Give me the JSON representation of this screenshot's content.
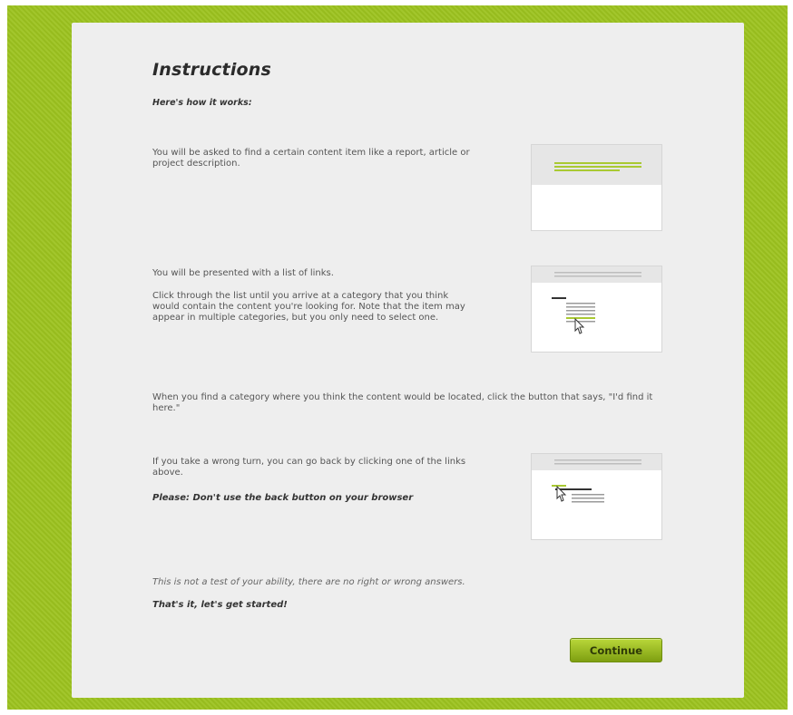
{
  "instructions": {
    "title": "Instructions",
    "subtitle": "Here's how it works:",
    "step1": "You will be asked to find a certain content item like a report, article or project description.",
    "step2_line1": "You will be presented with a list of links.",
    "step2_line2": "Click through the list until you arrive at a category that you think would contain the content you're looking for. Note that the item may appear in multiple categories, but you only need to select one.",
    "step3": "When you find a category where you think the content would be located, click the button that says, \"I'd find it here.\"",
    "step4_line1": "If you take a wrong turn, you can go back by clicking one of the links above.",
    "step4_warning": "Please: Don't use the back button on your browser",
    "note": "This is not a test of your ability, there are no right or wrong answers.",
    "closing": "That's it, let's get started!"
  },
  "illustrations": [
    {
      "icon": "search-task-illustration"
    },
    {
      "icon": "link-list-click-illustration"
    },
    {
      "icon": "go-back-illustration"
    }
  ],
  "continue_button": {
    "label": "Continue"
  },
  "colors": {
    "frame": "#9cc21f",
    "accent": "#a9c932",
    "panel": "#eeeeee",
    "button": "#8fb019"
  }
}
